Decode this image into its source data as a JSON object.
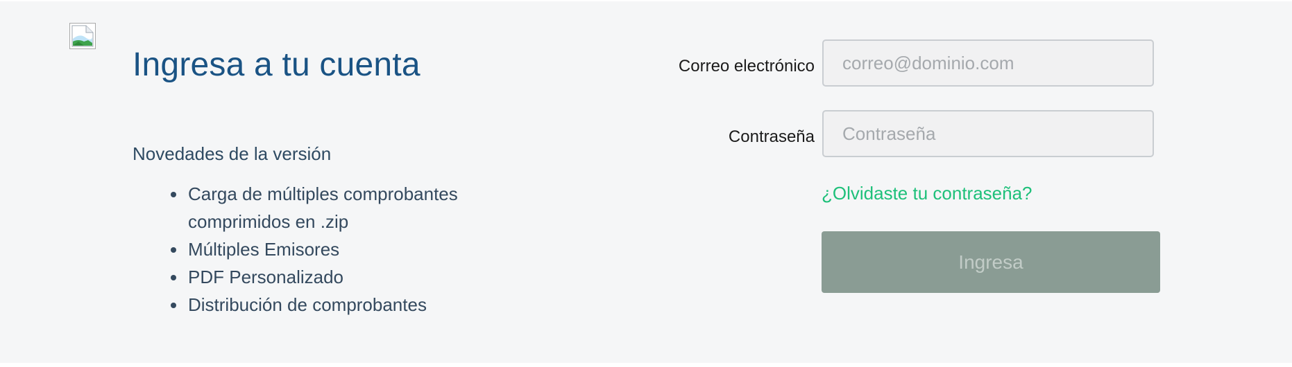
{
  "logo": {
    "icon": "broken-image-icon"
  },
  "heading": {
    "title": "Ingresa a tu cuenta"
  },
  "news": {
    "heading": "Novedades de la versión",
    "items": [
      "Carga de múltiples comprobantes comprimidos en .zip",
      "Múltiples Emisores",
      "PDF Personalizado",
      "Distribución de comprobantes"
    ]
  },
  "login_form": {
    "email": {
      "label": "Correo electrónico",
      "placeholder": "correo@dominio.com",
      "value": ""
    },
    "password": {
      "label": "Contraseña",
      "placeholder": "Contraseña",
      "value": ""
    },
    "forgot_link": "¿Olvidaste tu contraseña?",
    "submit_label": "Ingresa"
  },
  "colors": {
    "background": "#f5f6f7",
    "title": "#1a5384",
    "link": "#1ec07a",
    "button_bg": "#8a9c94",
    "button_text": "#c2ccc7"
  }
}
